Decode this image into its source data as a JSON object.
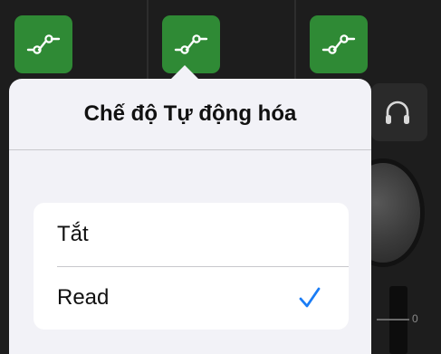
{
  "popover": {
    "title": "Chế độ Tự động hóa",
    "options": [
      {
        "label": "Tắt",
        "selected": false
      },
      {
        "label": "Read",
        "selected": true
      }
    ]
  },
  "mixer": {
    "automation_buttons": [
      "automation-curve-icon",
      "automation-curve-icon",
      "automation-curve-icon"
    ],
    "headphone_icon": "headphones-icon",
    "fader_scale_label": "0"
  },
  "colors": {
    "automation_button": "#2f8a35",
    "popover_background": "#f2f2f7",
    "checkmark": "#1a7cf5",
    "mixer_background": "#1d1d1d"
  }
}
